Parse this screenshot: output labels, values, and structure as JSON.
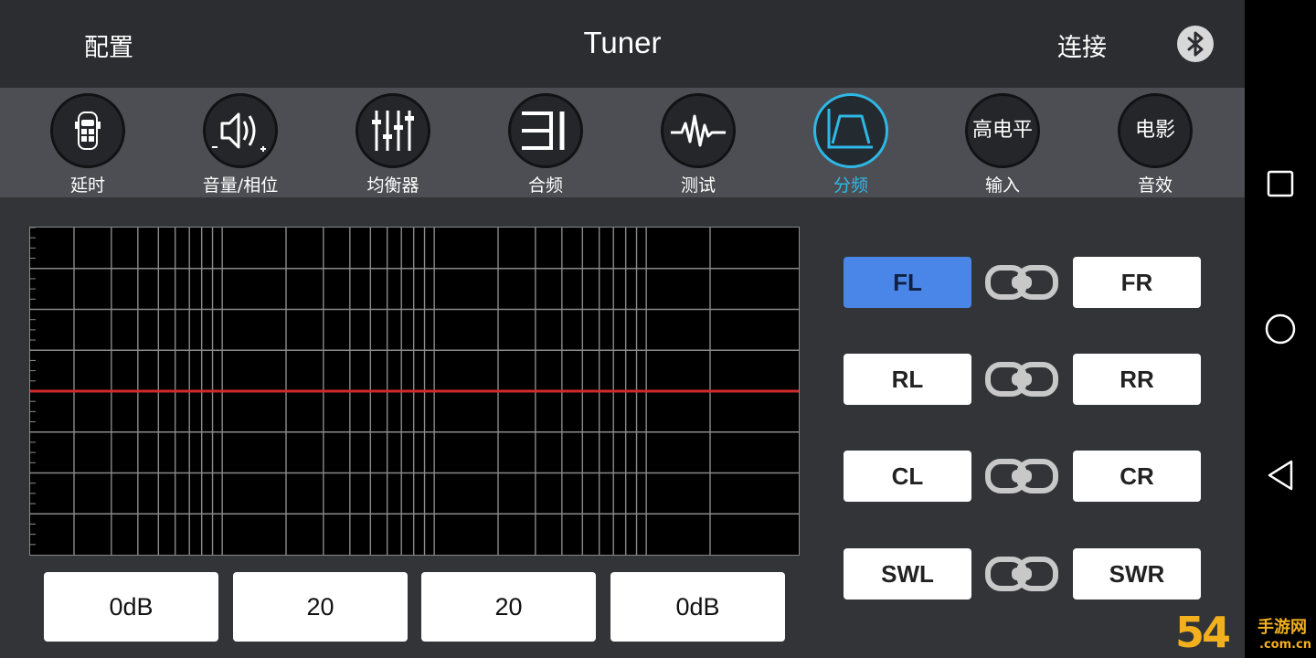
{
  "header": {
    "config_label": "配置",
    "title": "Tuner",
    "connect_label": "连接",
    "bluetooth_icon": "bluetooth-icon"
  },
  "tabs": [
    {
      "id": "delay",
      "label": "延时",
      "icon": "car-seat-icon"
    },
    {
      "id": "volume",
      "label": "音量/相位",
      "icon": "speaker-volume-icon"
    },
    {
      "id": "eq",
      "label": "均衡器",
      "icon": "equalizer-sliders-icon"
    },
    {
      "id": "mix",
      "label": "合频",
      "icon": "mix-bars-icon"
    },
    {
      "id": "test",
      "label": "测试",
      "icon": "waveform-icon"
    },
    {
      "id": "crossover",
      "label": "分频",
      "icon": "crossover-filter-icon",
      "active": true
    },
    {
      "id": "highlevel",
      "label": "输入",
      "glyph": "高电平"
    },
    {
      "id": "effects",
      "label": "音效",
      "glyph": "电影"
    }
  ],
  "graph": {
    "background": "#000000",
    "grid_color": "#8a8a8a",
    "curve_color": "#d42a2a",
    "curve_level": 0.5
  },
  "params": [
    "0dB",
    "20",
    "20",
    "0dB"
  ],
  "channels": [
    {
      "left": "FL",
      "right": "FR",
      "left_active": true
    },
    {
      "left": "RL",
      "right": "RR"
    },
    {
      "left": "CL",
      "right": "CR"
    },
    {
      "left": "SWL",
      "right": "SWR"
    }
  ],
  "colors": {
    "accent": "#2fb8e6",
    "active_channel": "#4a86e8"
  },
  "watermark": {
    "number": "54",
    "brand": "手游网",
    "domain": ".com.cn"
  }
}
